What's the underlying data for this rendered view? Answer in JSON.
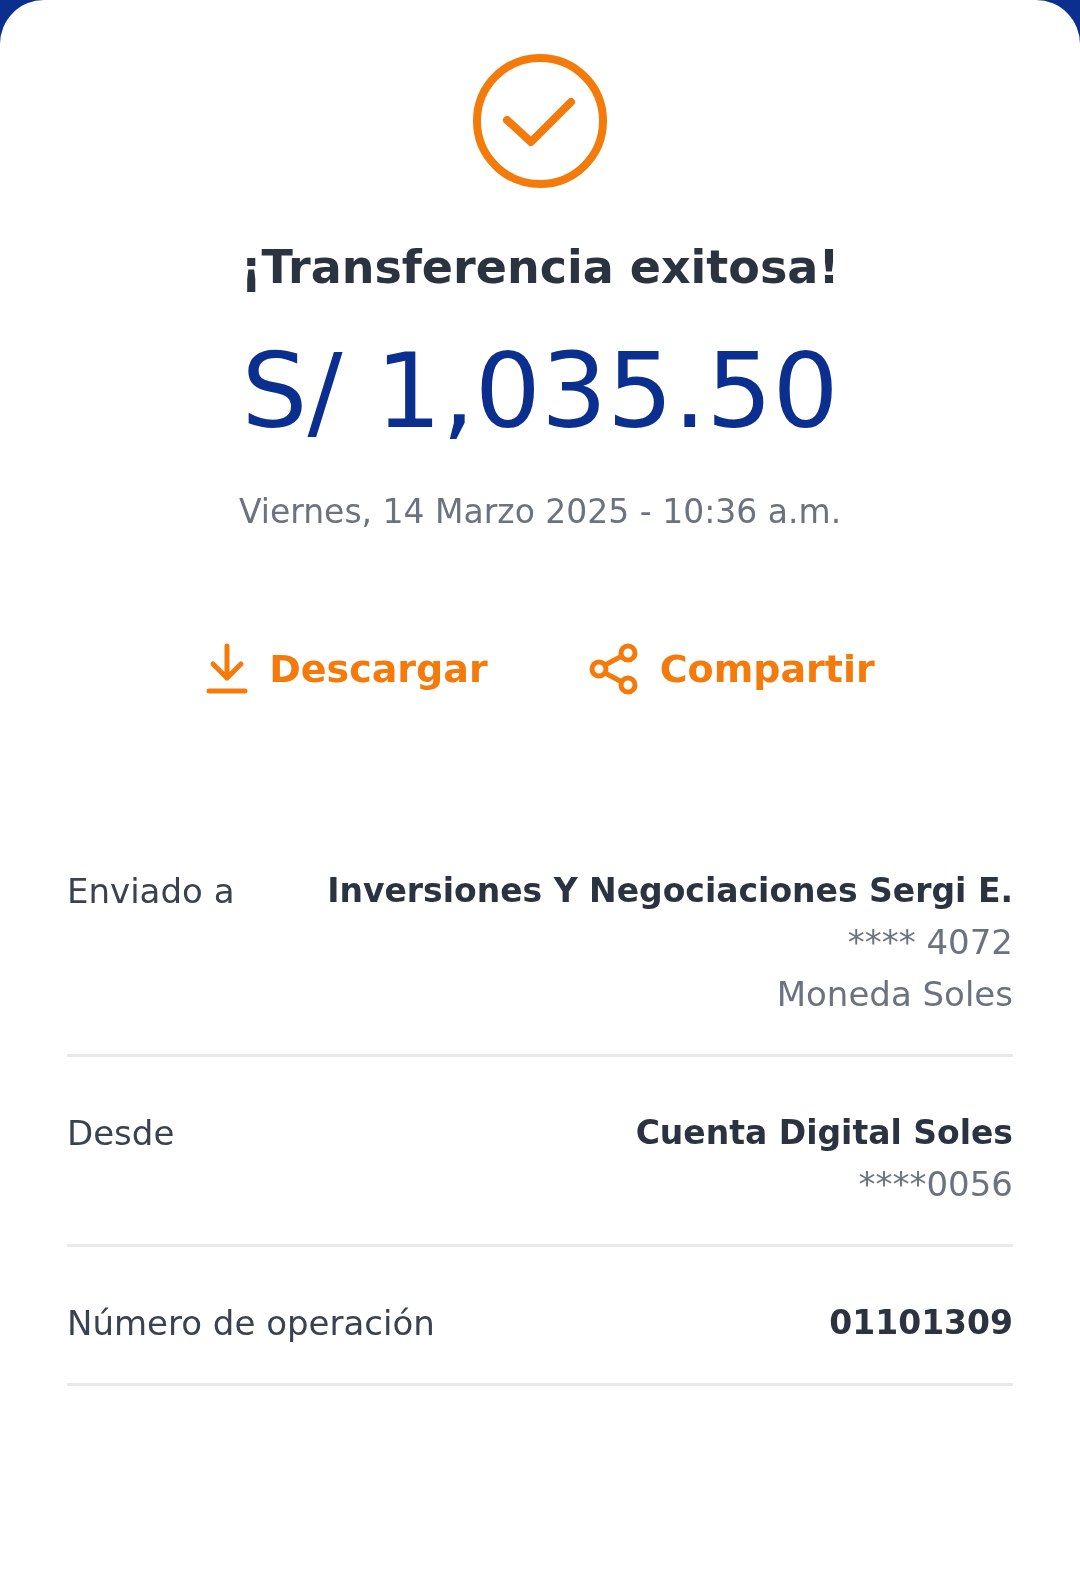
{
  "status": {
    "title": "¡Transferencia exitosa!",
    "amount": "S/ 1,035.50",
    "date": "Viernes, 14 Marzo 2025 - 10:36 a.m."
  },
  "actions": [
    {
      "label": "Descargar",
      "kind": "download"
    },
    {
      "label": "Compartir",
      "kind": "share"
    }
  ],
  "details": [
    {
      "label": "Enviado a",
      "lines": [
        {
          "text": "Inversiones Y Negociaciones Sergi E.",
          "kind": "primary"
        },
        {
          "text": "**** 4072",
          "kind": "secondary"
        },
        {
          "text": "Moneda Soles",
          "kind": "secondary"
        }
      ]
    },
    {
      "label": "Desde",
      "lines": [
        {
          "text": "Cuenta Digital Soles",
          "kind": "primary"
        },
        {
          "text": "****0056",
          "kind": "secondary"
        }
      ]
    },
    {
      "label": "Número de operación",
      "lines": [
        {
          "text": "01101309",
          "kind": "primary"
        }
      ]
    }
  ]
}
